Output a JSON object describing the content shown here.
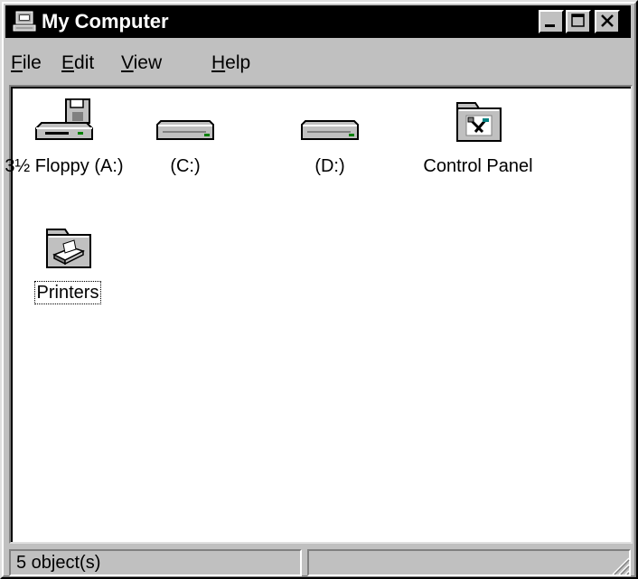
{
  "window": {
    "title": "My Computer",
    "buttons": {
      "minimize": "minimize",
      "maximize": "maximize",
      "close": "close"
    }
  },
  "menu": {
    "items": [
      {
        "accel": "F",
        "rest": "ile"
      },
      {
        "accel": "E",
        "rest": "dit"
      },
      {
        "accel": "V",
        "rest": "iew"
      },
      {
        "accel": "H",
        "rest": "elp"
      }
    ]
  },
  "items": [
    {
      "label": "3½ Floppy (A:)",
      "icon": "floppy-drive-icon"
    },
    {
      "label": "(C:)",
      "icon": "hard-drive-icon"
    },
    {
      "label": "(D:)",
      "icon": "hard-drive-icon"
    },
    {
      "label": "Control Panel",
      "icon": "control-panel-folder-icon"
    },
    {
      "label": "Printers",
      "icon": "printers-folder-icon",
      "focused": true
    }
  ],
  "status": {
    "objects": "5 object(s)",
    "secondary": ""
  },
  "colors": {
    "titlebar": "#000000",
    "face": "#c0c0c0",
    "content": "#ffffff"
  }
}
